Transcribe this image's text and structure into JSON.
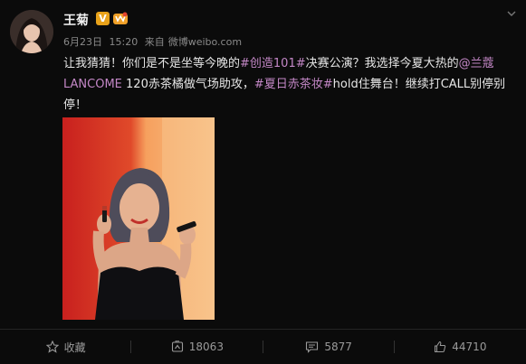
{
  "user": {
    "name": "王菊",
    "verified_mark": "V"
  },
  "post": {
    "date": "6月23日",
    "time": "15:20",
    "source_prefix": "来自",
    "source": "微博weibo.com",
    "text": {
      "p1": "让我猜猜！你们是不是坐等今晚的",
      "tag1": "#创造101#",
      "p2": "决赛公演？我选择今夏大热的",
      "mention": "@兰蔻LANCOME",
      "p3": " 120赤茶橘做气场助攻，",
      "tag2": "#夏日赤茶妆#",
      "p4": "hold住舞台！继续打CALL别停别停！"
    }
  },
  "actions": {
    "favorite": "收藏",
    "repost": "18063",
    "comment": "5877",
    "like": "44710"
  },
  "colors": {
    "background": "#0b0b0b",
    "link": "#c387c6",
    "verified": "#e8a21a"
  }
}
